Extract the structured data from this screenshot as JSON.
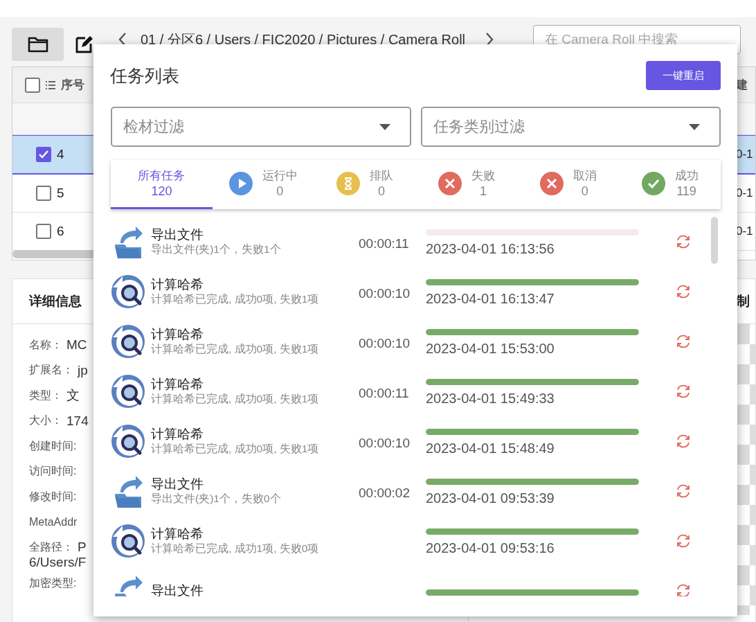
{
  "toolbar": {
    "breadcrumb": "01 / 分区6 / Users / FIC2020 / Pictures / Camera Roll",
    "search_placeholder": "在 Camera Roll 中搜索"
  },
  "file_table": {
    "columns": [
      "序号",
      "建"
    ],
    "all_checked": false,
    "rows": [
      {
        "index": "4",
        "column_2": "0-1",
        "checked": true,
        "selected": true
      },
      {
        "index": "5",
        "column_2": "0-1",
        "checked": false,
        "selected": false
      },
      {
        "index": "6",
        "column_2": "0-1",
        "checked": false,
        "selected": false
      }
    ]
  },
  "details": {
    "title": "详细信息",
    "fields": [
      {
        "label": "名称：",
        "value": "MC"
      },
      {
        "label": "扩展名：",
        "value": "jp"
      },
      {
        "label": "类型：",
        "value": "文"
      },
      {
        "label": "大小：",
        "value": "174"
      },
      {
        "label": "创建时间:"
      },
      {
        "label": "访问时间:"
      },
      {
        "label": "修改时间:"
      },
      {
        "label": "MetaAddr"
      },
      {
        "label": "全路径：",
        "value": "P",
        "continuation": "6/Users/F"
      },
      {
        "label": "加密类型:"
      }
    ]
  },
  "preview": {
    "title": "制"
  },
  "dialog": {
    "title": "任务列表",
    "restart_button": "一键重启",
    "filters": [
      {
        "placeholder": "检材过滤"
      },
      {
        "placeholder": "任务类别过滤"
      }
    ],
    "tabs": [
      {
        "kind": "all",
        "label": "所有任务",
        "count": "120",
        "selected": true
      },
      {
        "kind": "running",
        "label": "运行中",
        "count": "0",
        "selected": false
      },
      {
        "kind": "queued",
        "label": "排队",
        "count": "0",
        "selected": false
      },
      {
        "kind": "failed",
        "label": "失败",
        "count": "1",
        "selected": false
      },
      {
        "kind": "cancelled",
        "label": "取消",
        "count": "0",
        "selected": false
      },
      {
        "kind": "success",
        "label": "成功",
        "count": "119",
        "selected": false
      }
    ],
    "tasks": [
      {
        "kind": "export",
        "title": "导出文件",
        "subtitle": "导出文件(夹)1个，失败1个",
        "duration": "00:00:11",
        "level": 0,
        "time": "2023-04-01 16:13:56"
      },
      {
        "kind": "hash",
        "title": "计算哈希",
        "subtitle": "计算哈希已完成, 成功0项, 失败1项",
        "duration": "00:00:10",
        "level": 1,
        "time": "2023-04-01 16:13:47"
      },
      {
        "kind": "hash",
        "title": "计算哈希",
        "subtitle": "计算哈希已完成, 成功0项, 失败1项",
        "duration": "00:00:10",
        "level": 1,
        "time": "2023-04-01 15:53:00"
      },
      {
        "kind": "hash",
        "title": "计算哈希",
        "subtitle": "计算哈希已完成, 成功0项, 失败1项",
        "duration": "00:00:11",
        "level": 1,
        "time": "2023-04-01 15:49:33"
      },
      {
        "kind": "hash",
        "title": "计算哈希",
        "subtitle": "计算哈希已完成, 成功0项, 失败1项",
        "duration": "00:00:10",
        "level": 1,
        "time": "2023-04-01 15:48:49"
      },
      {
        "kind": "export",
        "title": "导出文件",
        "subtitle": "导出文件(夹)1个，失败0个",
        "duration": "00:00:02",
        "level": 1,
        "time": "2023-04-01 09:53:39"
      },
      {
        "kind": "hash",
        "title": "计算哈希",
        "subtitle": "计算哈希已完成, 成功1项, 失败0项",
        "level": 1,
        "time": "2023-04-01 09:53:16"
      },
      {
        "kind": "export",
        "title": "导出文件",
        "level": 1
      }
    ]
  }
}
